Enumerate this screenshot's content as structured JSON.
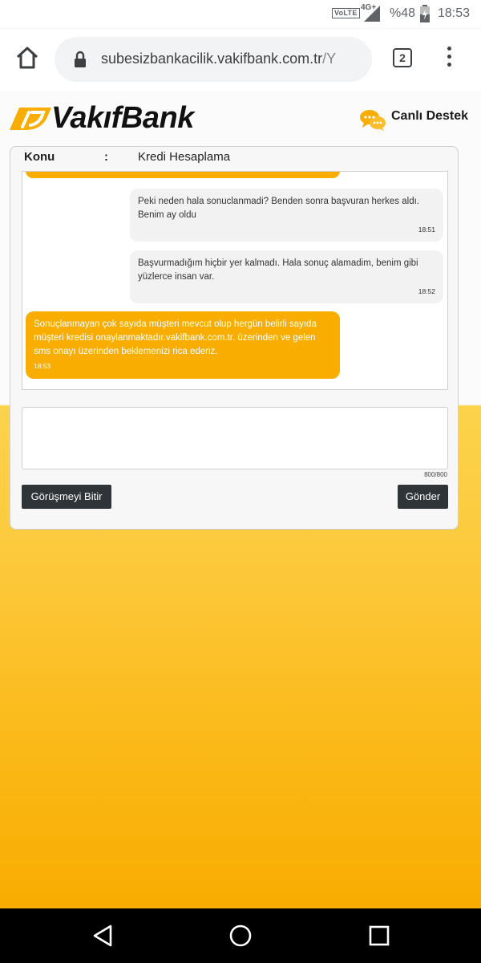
{
  "status_bar": {
    "volte": "VoLTE",
    "network": "4G+",
    "battery": "%48",
    "time": "18:53"
  },
  "browser": {
    "url_main": "subesizbankacilik.vakifbank.com.tr",
    "url_rest": "/Y",
    "tab_count": "2"
  },
  "header": {
    "brand": "VakıfBank",
    "support_label": "Canlı Destek"
  },
  "conversation": {
    "subject_label": "Konu",
    "subject_separator": ":",
    "subject_value": "Kredi Hesaplama",
    "messages": [
      {
        "from": "customer",
        "text": "Peki neden hala sonuclanmadi? Benden sonra başvuran herkes aldı. Benim ay oldu",
        "time": "18:51"
      },
      {
        "from": "customer",
        "text": "Başvurmadığım hiçbir yer kalmadı. Hala sonuç alamadim, benim gibi yüzlerce insan var.",
        "time": "18:52"
      },
      {
        "from": "agent",
        "text": "Sonuçlanmayan çok sayıda müşteri mevcut olup hergün belirli sayıda müşteri kredisi onaylanmaktadır.vakifbank.com.tr. üzerinden ve gelen sms onayı üzerinden beklemenizi rica ederiz.",
        "time": "18:53"
      }
    ],
    "input_value": "",
    "char_counter": "800/800",
    "end_button": "Görüşmeyi Bitir",
    "send_button": "Gönder"
  },
  "colors": {
    "brand_yellow": "#f9ad00",
    "button_dark": "#2e3438"
  }
}
